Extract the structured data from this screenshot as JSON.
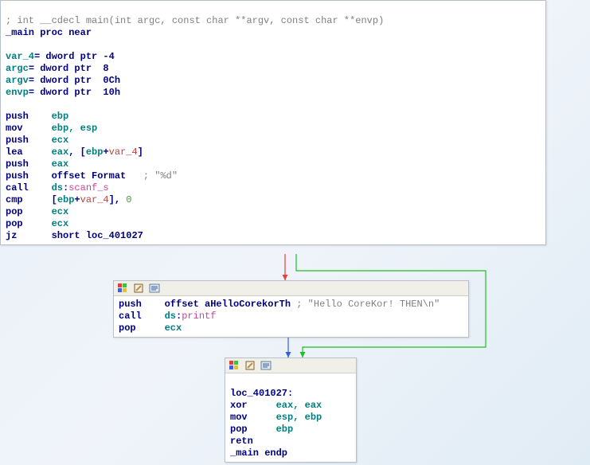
{
  "node1": {
    "comment": "; int __cdecl main(int argc, const char **argv, const char **envp)",
    "proc": "_main proc near",
    "stack": [
      {
        "name": "var_4",
        "eq": "=",
        "decl": "dword ptr -4"
      },
      {
        "name": "argc",
        "eq": "=",
        "decl": "dword ptr  8"
      },
      {
        "name": "argv",
        "eq": "=",
        "decl": "dword ptr  0Ch"
      },
      {
        "name": "envp",
        "eq": "=",
        "decl": "dword ptr  10h"
      }
    ],
    "ins": [
      {
        "op": "push",
        "args": [
          {
            "t": "ebp",
            "c": "teal"
          }
        ]
      },
      {
        "op": "mov",
        "args": [
          {
            "t": "ebp, esp",
            "c": "teal"
          }
        ]
      },
      {
        "op": "push",
        "args": [
          {
            "t": "ecx",
            "c": "teal"
          }
        ]
      },
      {
        "op": "lea",
        "args": [
          {
            "t": "eax",
            "c": "teal"
          },
          {
            "t": ", [",
            "c": "navy"
          },
          {
            "t": "ebp",
            "c": "teal"
          },
          {
            "t": "+",
            "c": "navy"
          },
          {
            "t": "var_4",
            "c": "red"
          },
          {
            "t": "]",
            "c": "navy"
          }
        ]
      },
      {
        "op": "push",
        "args": [
          {
            "t": "eax",
            "c": "teal"
          }
        ]
      },
      {
        "op": "push",
        "args": [
          {
            "t": "offset ",
            "c": "navy"
          },
          {
            "t": "Format",
            "c": "navy"
          },
          {
            "t": "   ; ",
            "c": "gray"
          },
          {
            "t": "\"%d\"",
            "c": "gray"
          }
        ]
      },
      {
        "op": "call",
        "args": [
          {
            "t": "ds",
            "c": "teal"
          },
          {
            "t": ":",
            "c": "navy"
          },
          {
            "t": "scanf_s",
            "c": "pink"
          }
        ]
      },
      {
        "op": "cmp",
        "args": [
          {
            "t": "[",
            "c": "navy"
          },
          {
            "t": "ebp",
            "c": "teal"
          },
          {
            "t": "+",
            "c": "navy"
          },
          {
            "t": "var_4",
            "c": "red"
          },
          {
            "t": "], ",
            "c": "navy"
          },
          {
            "t": "0",
            "c": "ltgreen"
          }
        ]
      },
      {
        "op": "pop",
        "args": [
          {
            "t": "ecx",
            "c": "teal"
          }
        ]
      },
      {
        "op": "pop",
        "args": [
          {
            "t": "ecx",
            "c": "teal"
          }
        ]
      },
      {
        "op": "jz",
        "args": [
          {
            "t": "short ",
            "c": "navy"
          },
          {
            "t": "loc_401027",
            "c": "navy"
          }
        ]
      }
    ]
  },
  "node2": {
    "ins": [
      {
        "op": "push",
        "args": [
          {
            "t": "offset ",
            "c": "navy"
          },
          {
            "t": "aHelloCorekorTh",
            "c": "navy"
          },
          {
            "t": " ; ",
            "c": "gray"
          },
          {
            "t": "\"Hello CoreKor! THEN\\n\"",
            "c": "gray"
          }
        ]
      },
      {
        "op": "call",
        "args": [
          {
            "t": "ds",
            "c": "teal"
          },
          {
            "t": ":",
            "c": "navy"
          },
          {
            "t": "printf",
            "c": "pink"
          }
        ]
      },
      {
        "op": "pop",
        "args": [
          {
            "t": "ecx",
            "c": "teal"
          }
        ]
      }
    ]
  },
  "node3": {
    "label": "loc_401027:",
    "ins": [
      {
        "op": "xor",
        "args": [
          {
            "t": "eax, eax",
            "c": "teal"
          }
        ]
      },
      {
        "op": "mov",
        "args": [
          {
            "t": "esp, ebp",
            "c": "teal"
          }
        ]
      },
      {
        "op": "pop",
        "args": [
          {
            "t": "ebp",
            "c": "teal"
          }
        ]
      },
      {
        "op": "retn",
        "args": []
      }
    ],
    "endp": "_main endp"
  }
}
